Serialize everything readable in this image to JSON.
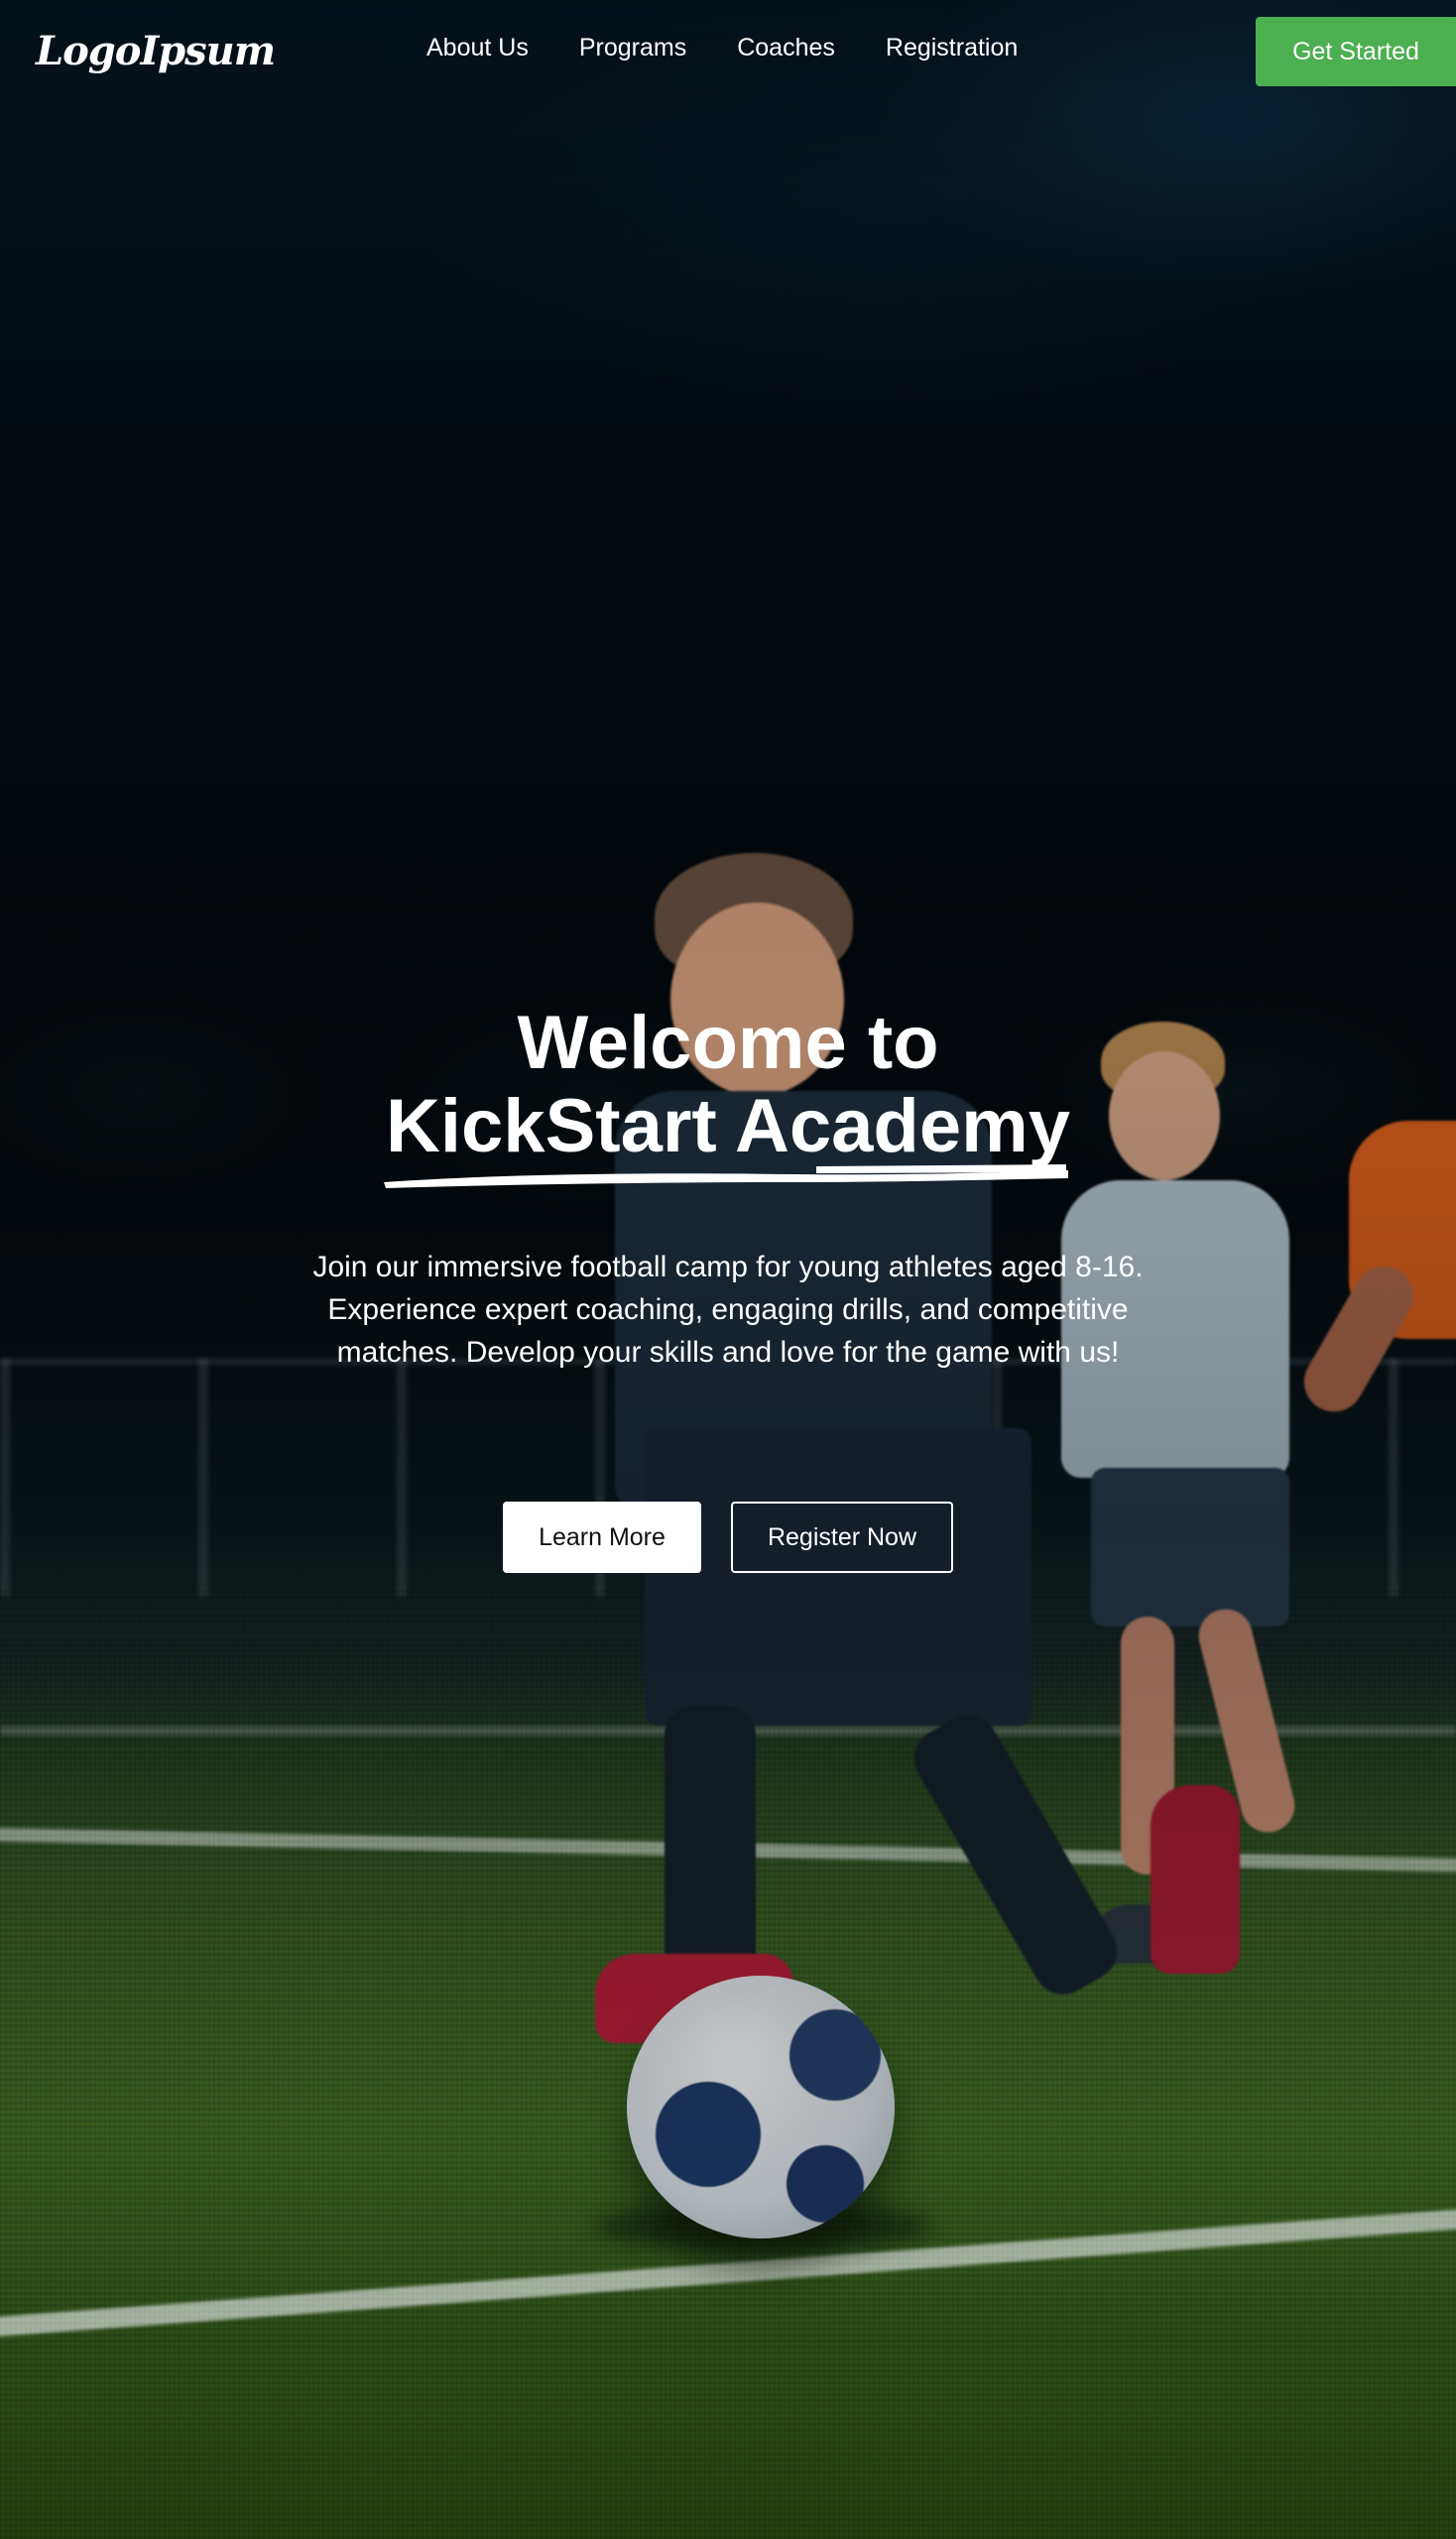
{
  "brand": {
    "logo_text": "LogoIpsum"
  },
  "nav": {
    "links": [
      {
        "label": "About Us"
      },
      {
        "label": "Programs"
      },
      {
        "label": "Coaches"
      },
      {
        "label": "Registration"
      }
    ],
    "cta_label": "Get Started"
  },
  "hero": {
    "title_line1": "Welcome to",
    "title_line2": "KickStart Academy",
    "description": "Join our immersive football camp for young athletes aged 8-16. Experience expert coaching, engaging drills, and competitive matches. Develop your skills and love for the game with us!",
    "primary_button": "Learn More",
    "secondary_button": "Register Now",
    "background_image": "youth-football-players-night-field"
  },
  "colors": {
    "accent_green": "#4caf50",
    "text": "#ffffff",
    "primary_button_bg": "#ffffff",
    "primary_button_text": "#111111"
  }
}
